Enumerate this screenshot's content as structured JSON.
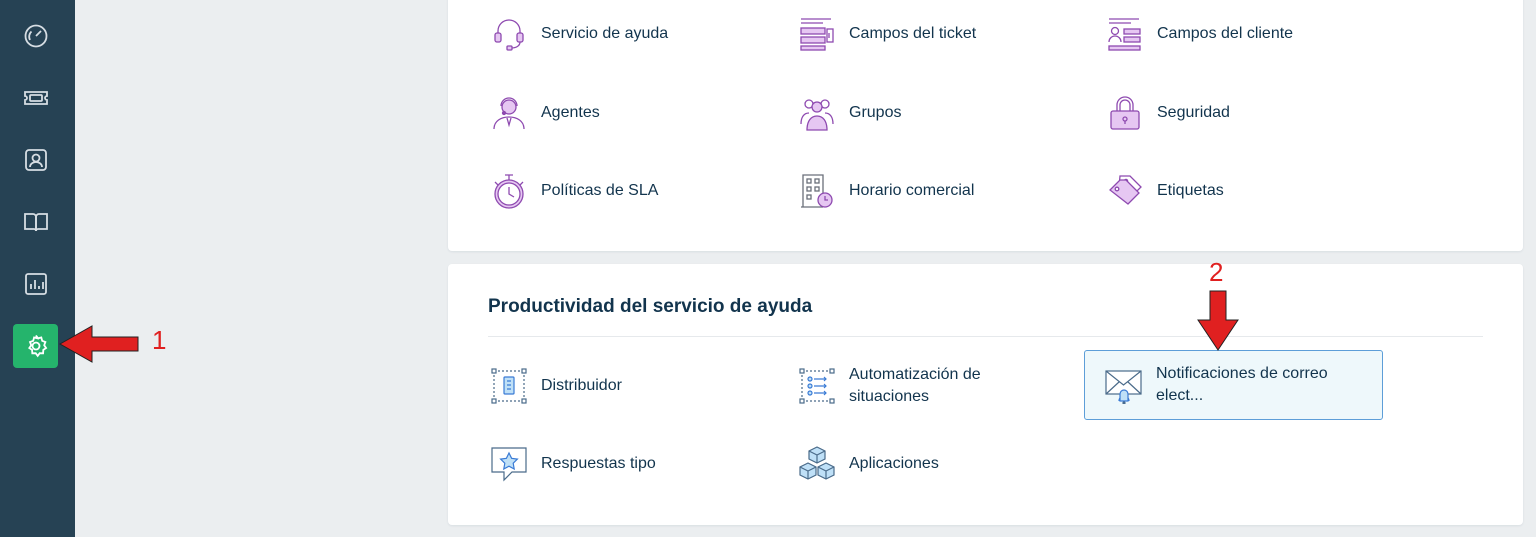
{
  "sidebar": {
    "items": [
      {
        "name": "dashboard",
        "icon": "speedometer-icon"
      },
      {
        "name": "tickets",
        "icon": "ticket-icon"
      },
      {
        "name": "contacts",
        "icon": "contact-card-icon"
      },
      {
        "name": "solutions",
        "icon": "book-icon"
      },
      {
        "name": "reports",
        "icon": "bar-chart-icon"
      },
      {
        "name": "admin",
        "icon": "gear-icon"
      }
    ],
    "active_color": "#25b46c",
    "bg_color": "#264254"
  },
  "top_section": {
    "items": [
      {
        "label": "Servicio de ayuda",
        "icon": "headset-icon"
      },
      {
        "label": "Campos del ticket",
        "icon": "ticket-fields-icon"
      },
      {
        "label": "Campos del cliente",
        "icon": "customer-fields-icon"
      },
      {
        "label": "Agentes",
        "icon": "agent-icon"
      },
      {
        "label": "Grupos",
        "icon": "group-icon"
      },
      {
        "label": "Seguridad",
        "icon": "padlock-icon"
      },
      {
        "label": "Políticas de SLA",
        "icon": "stopwatch-icon"
      },
      {
        "label": "Horario comercial",
        "icon": "building-clock-icon"
      },
      {
        "label": "Etiquetas",
        "icon": "tags-icon"
      }
    ]
  },
  "productivity_section": {
    "title": "Productividad del servicio de ayuda",
    "items": [
      {
        "label": "Distribuidor",
        "icon": "dispatcher-icon"
      },
      {
        "label": "Automatización de situaciones",
        "icon": "automation-icon"
      },
      {
        "label": "Notificaciones de correo elect...",
        "icon": "envelope-bell-icon"
      },
      {
        "label": "Respuestas tipo",
        "icon": "canned-response-icon"
      },
      {
        "label": "Aplicaciones",
        "icon": "cubes-icon"
      }
    ]
  },
  "annotations": {
    "marker_1": "1",
    "marker_2": "2",
    "arrow_color": "#e02020"
  }
}
